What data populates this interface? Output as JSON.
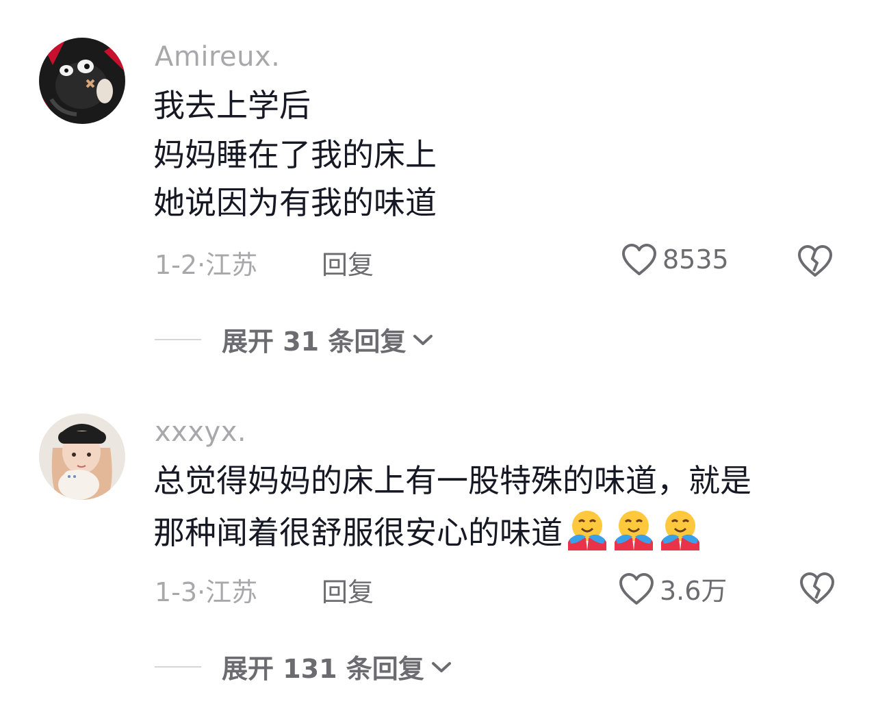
{
  "comments": [
    {
      "username": "Amireux.",
      "text_lines": [
        "我去上学后",
        "妈妈睡在了我的床上",
        "她说因为有我的味道"
      ],
      "meta": "1-2·江苏",
      "reply_label": "回复",
      "likes": "8535",
      "expand_label": "展开 31 条回复"
    },
    {
      "username": "xxxyx.",
      "text_lines": [
        "总觉得妈妈的床上有一股特殊的味道，就是",
        "那种闻着很舒服很安心的味道"
      ],
      "emoji": [
        "smiling-face-with-open-hands",
        "smiling-face-with-open-hands",
        "smiling-face-with-open-hands"
      ],
      "meta": "1-3·江苏",
      "reply_label": "回复",
      "likes": "3.6万",
      "expand_label": "展开 131 条回复"
    }
  ],
  "colors": {
    "text": "#161823",
    "secondary": "#a8a8ab",
    "action": "#6b6b70"
  }
}
